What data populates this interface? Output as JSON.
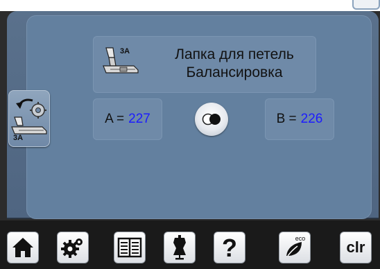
{
  "title": {
    "foot_badge": "3A",
    "line1": "Лапка для петель",
    "line2": "Балансировка"
  },
  "side_button": {
    "badge": "3A"
  },
  "values": {
    "a_label": "A =",
    "a_value": "227",
    "b_label": "B =",
    "b_value": "226"
  },
  "bottom_bar": {
    "eco_label": "eco",
    "clr_label": "clr"
  },
  "colors": {
    "value_text": "#1c1cff",
    "panel": "#63809f",
    "bar": "#1a1a1a"
  },
  "icons": [
    "home-icon",
    "settings-icon",
    "manual-icon",
    "dress-form-icon",
    "help-icon",
    "eco-icon",
    "presser-foot-icon",
    "rotate-arrow-icon"
  ]
}
